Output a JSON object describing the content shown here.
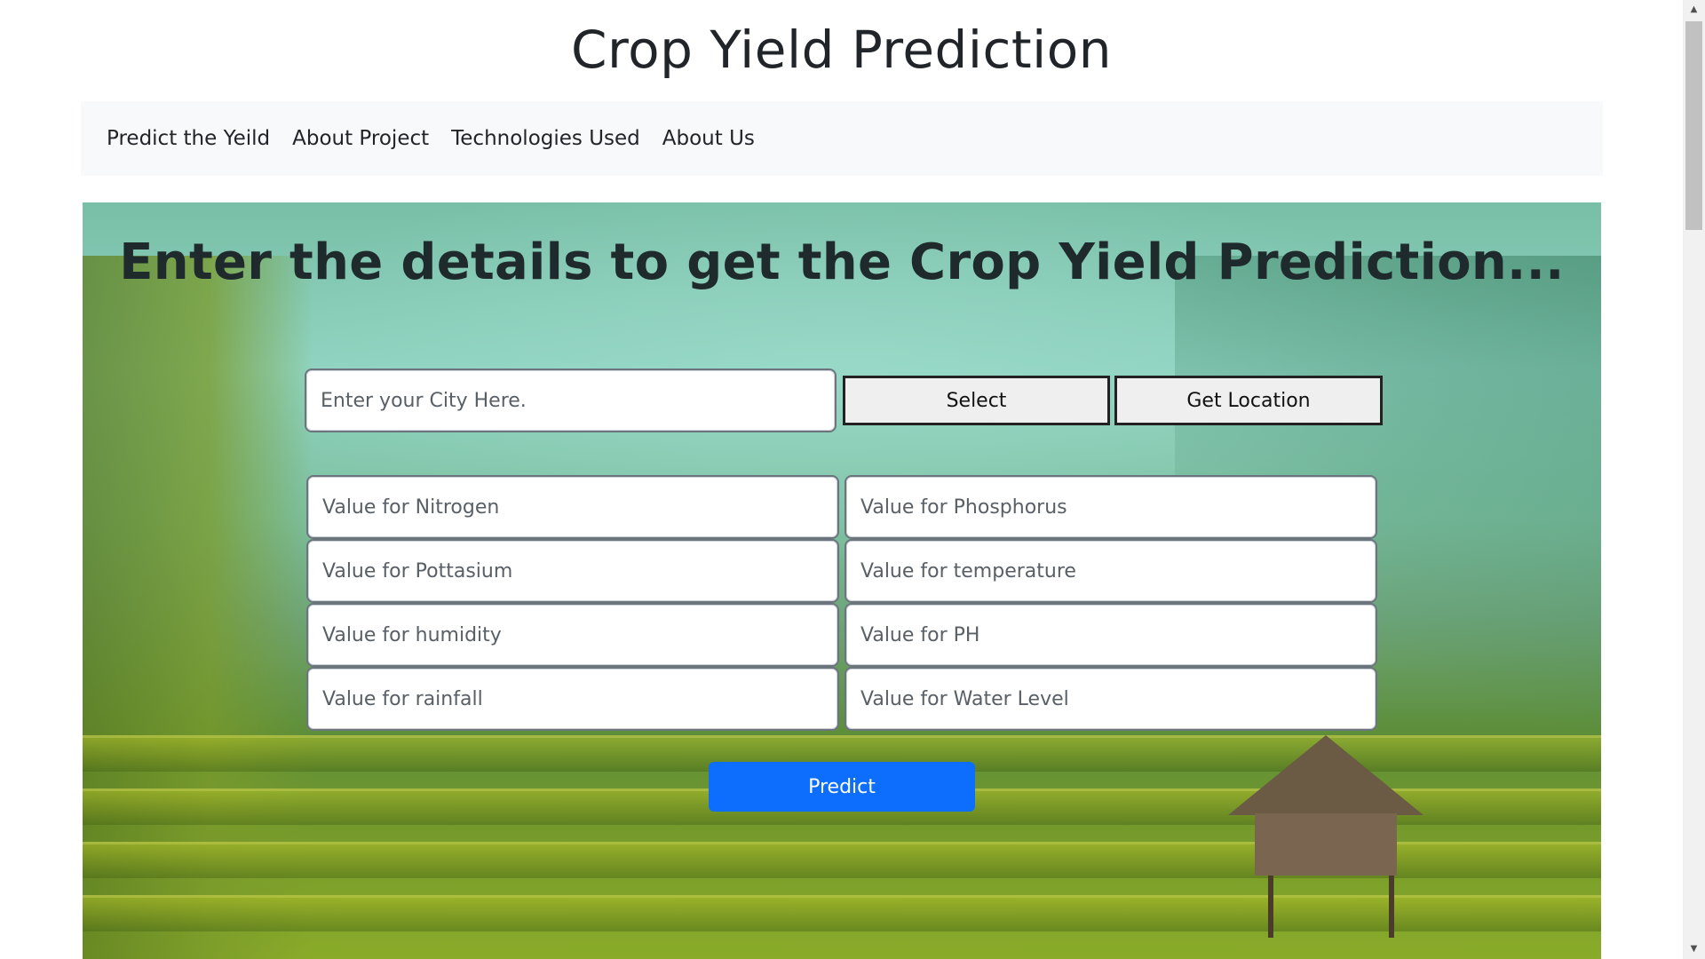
{
  "page": {
    "title": "Crop Yield Prediction"
  },
  "nav": {
    "items": [
      {
        "label": "Predict the Yeild"
      },
      {
        "label": "About Project"
      },
      {
        "label": "Technologies Used"
      },
      {
        "label": "About Us"
      }
    ]
  },
  "hero": {
    "heading": "Enter the details to get the Crop Yield Prediction...",
    "city_placeholder": "Enter your City Here.",
    "select_label": "Select",
    "location_label": "Get Location",
    "fields": {
      "nitrogen": "Value for Nitrogen",
      "phosphorus": "Value for Phosphorus",
      "pottasium": "Value for Pottasium",
      "temperature": "Value for temperature",
      "humidity": "Value for humidity",
      "ph": "Value for PH",
      "rainfall": "Value for rainfall",
      "water_level": "Value for Water Level"
    },
    "predict_label": "Predict"
  },
  "scrollbar": {
    "up_icon": "arrow-up-icon",
    "down_icon": "arrow-down-icon"
  },
  "colors": {
    "primary": "#0d6efd",
    "navbar_bg": "#f8f9fa",
    "text": "#212529"
  }
}
